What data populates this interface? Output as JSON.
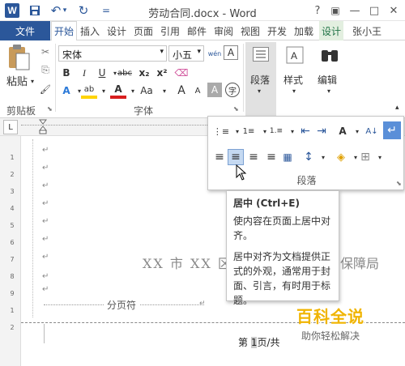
{
  "window": {
    "title": "劳动合同.docx - Word",
    "help": "?",
    "restore": "▣",
    "minimize": "—",
    "maximize": "□",
    "close": "✕"
  },
  "quick_access": {
    "logo": "W",
    "save": "💾",
    "undo": "↶",
    "undo_drop": "▾",
    "redo": "↻",
    "customize": "="
  },
  "tabs": {
    "file": "文件",
    "items": [
      "开始",
      "插入",
      "设计",
      "页面",
      "引用",
      "邮件",
      "审阅",
      "视图",
      "开发",
      "加载",
      "设计",
      "张小王"
    ]
  },
  "clipboard": {
    "paste_label": "粘贴",
    "cut": "✂",
    "copy": "⎘",
    "brush": "🖌",
    "group_label": "剪贴板"
  },
  "font": {
    "name": "宋体",
    "size": "小五",
    "phonetic": "wén",
    "char_border": "A",
    "bold": "B",
    "italic": "I",
    "underline": "U",
    "strike": "abc",
    "sub": "x₂",
    "sup": "x²",
    "eraser": "⌫",
    "text_effect": "A",
    "highlight": "ab",
    "font_color": "A",
    "change_case": "Aa",
    "grow": "A",
    "shrink": "A",
    "shade": "A",
    "enclose": "字",
    "group_label": "字体"
  },
  "paragraph_btn": "段落",
  "styles_btn": "样式",
  "editing_btn": "编辑",
  "popup": {
    "bullets": "⋮≡",
    "numbering": "1≡",
    "multilevel": "1.≡",
    "dec_indent": "⇤",
    "inc_indent": "⇥",
    "chinese_layout": "A",
    "sort": "A↓",
    "show_marks": "↵",
    "align_left": "≡",
    "align_center": "≡",
    "align_right": "≡",
    "justify": "≡",
    "distribute": "▦",
    "line_spacing": "↕",
    "shading": "◈",
    "borders": "⊞",
    "label": "段落"
  },
  "tooltip": {
    "title": "居中 (Ctrl+E)",
    "line1": "使内容在页面上居中对齐。",
    "line2": "居中对齐为文档提供正式的外观，通常用于封面、引言，有时用于标题。"
  },
  "document": {
    "heading_left": "XX 市 XX 区",
    "heading_right": "保障局",
    "page_break_label": "分页符",
    "footer_prefix": "第 ",
    "footer_page": "1",
    "footer_suffix": "页/共 ",
    "para_mark": "↵"
  },
  "ruler": {
    "corner": "L",
    "v_numbers": [
      "1",
      "2",
      "3",
      "4",
      "5",
      "6",
      "7",
      "8",
      "9",
      "1",
      "2"
    ]
  },
  "watermark": {
    "title": "百科全说",
    "subtitle": "助你轻松解决"
  },
  "colors": {
    "word_blue": "#2b579a",
    "highlight_yellow": "#ffd400",
    "font_red": "#d81e1e",
    "selected": "#c5d9f1"
  }
}
